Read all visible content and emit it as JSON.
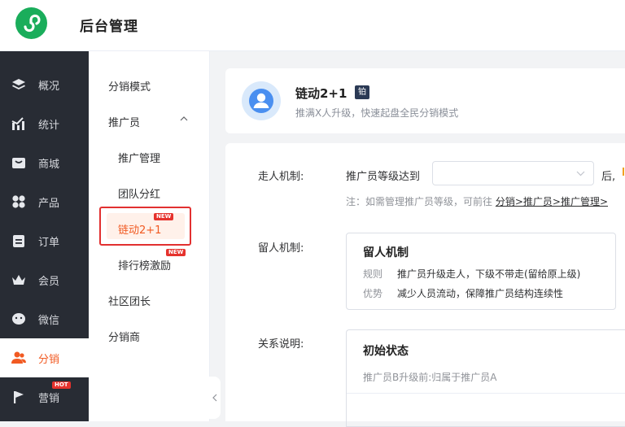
{
  "app": {
    "title": "后台管理",
    "logo_icon": "mini-program-logo-icon",
    "brand_color": "#1aad5b"
  },
  "sidebar": {
    "items": [
      {
        "label": "概况",
        "icon": "layers-icon"
      },
      {
        "label": "统计",
        "icon": "chart-icon"
      },
      {
        "label": "商城",
        "icon": "store-icon"
      },
      {
        "label": "产品",
        "icon": "grid-icon"
      },
      {
        "label": "订单",
        "icon": "order-icon"
      },
      {
        "label": "会员",
        "icon": "crown-icon"
      },
      {
        "label": "微信",
        "icon": "wechat-icon"
      },
      {
        "label": "分销",
        "icon": "users-icon",
        "active": true
      },
      {
        "label": "营销",
        "icon": "flag-icon",
        "badge": "HOT"
      }
    ],
    "accent_color": "#f15a22"
  },
  "subnav": {
    "items": [
      {
        "label": "分销模式"
      },
      {
        "label": "推广员",
        "expanded": true
      },
      {
        "label": "推广管理"
      },
      {
        "label": "团队分红"
      },
      {
        "label": "链动2+1",
        "badge": "NEW",
        "active": true
      },
      {
        "label": "排行榜激励",
        "badge": "NEW"
      },
      {
        "label": "社区团长"
      },
      {
        "label": "分销商"
      }
    ]
  },
  "plan": {
    "title": "链动2+1",
    "tier": "铂",
    "description": "推满X人升级，快速起盘全民分销模式"
  },
  "form": {
    "exit_label": "走人机制:",
    "exit_condition": "推广员等级达到",
    "exit_select_value": "",
    "exit_after": "后,",
    "note_prefix": "注：如需管理推广员等级，可前往",
    "note_link": "分销>推广员>推广管理>",
    "retain_label": "留人机制:",
    "retain_title": "留人机制",
    "retain_rule_key": "规则",
    "retain_rule_value": "推广员升级走人，下级不带走(留给原上级)",
    "retain_adv_key": "优势",
    "retain_adv_value": "减少人员流动，保障推广员结构连续性",
    "relation_label": "关系说明:",
    "relation_title": "初始状态",
    "relation_sub": "推广员B升级前:归属于推广员A"
  }
}
